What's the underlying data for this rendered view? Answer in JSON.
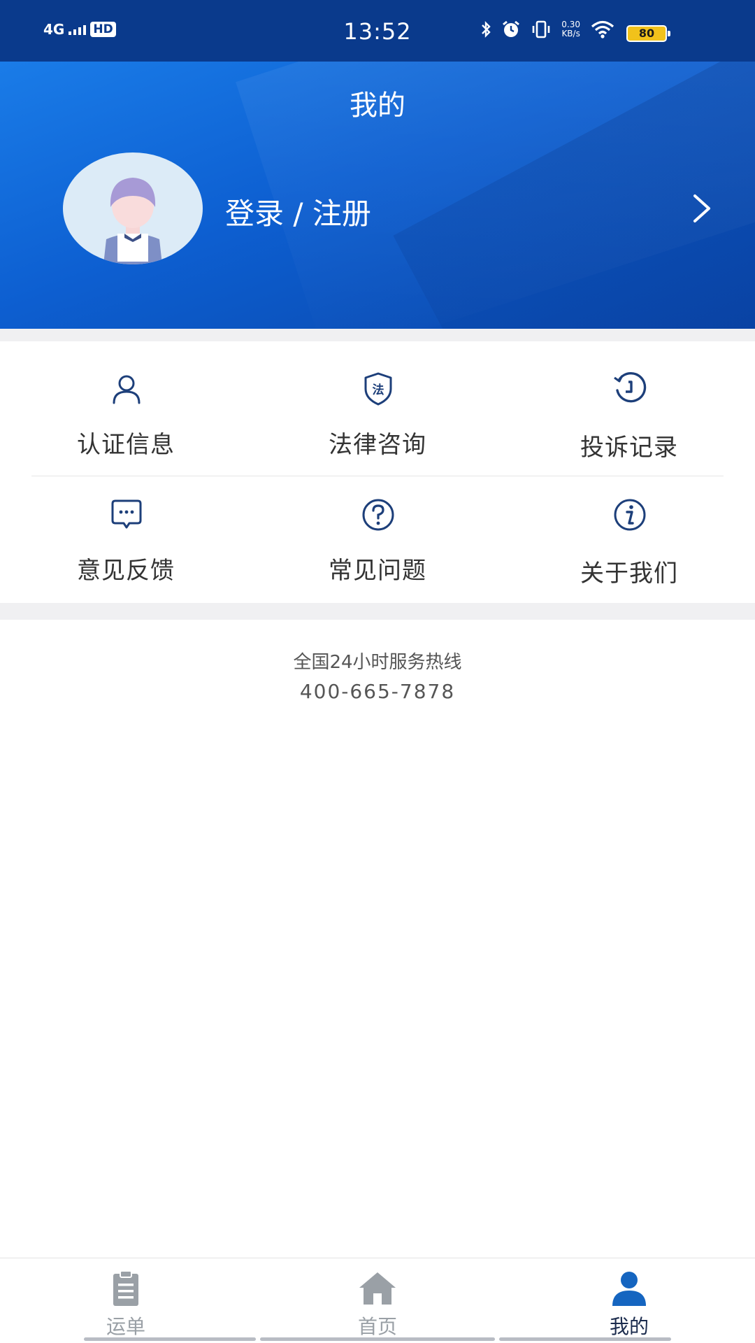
{
  "status_bar": {
    "network": "4G",
    "hd": "HD",
    "time": "13:52",
    "net_speed_value": "0.30",
    "net_speed_unit": "KB/s",
    "battery": "80",
    "icons": [
      "bluetooth-icon",
      "alarm-icon",
      "vibrate-icon",
      "wifi-icon"
    ]
  },
  "header": {
    "title": "我的",
    "login_label": "登录 / 注册",
    "colors": {
      "gradient_start": "#1a7ce8",
      "gradient_end": "#0a45a8"
    }
  },
  "menu": {
    "items": [
      {
        "label": "认证信息",
        "icon": "user-icon"
      },
      {
        "label": "法律咨询",
        "icon": "law-shield-icon"
      },
      {
        "label": "投诉记录",
        "icon": "history-clock-icon"
      },
      {
        "label": "意见反馈",
        "icon": "feedback-chat-icon"
      },
      {
        "label": "常见问题",
        "icon": "question-icon"
      },
      {
        "label": "关于我们",
        "icon": "info-icon"
      }
    ],
    "icon_color": "#1d3f7a",
    "law_glyph": "法"
  },
  "hotline": {
    "title": "全国24小时服务热线",
    "number": "400-665-7878"
  },
  "bottom_nav": {
    "items": [
      {
        "label": "运单",
        "icon": "clipboard-icon",
        "active": false
      },
      {
        "label": "首页",
        "icon": "home-icon",
        "active": false
      },
      {
        "label": "我的",
        "icon": "profile-icon",
        "active": true
      }
    ],
    "active_color": "#1565c0",
    "inactive_color": "#9aa0a6"
  }
}
